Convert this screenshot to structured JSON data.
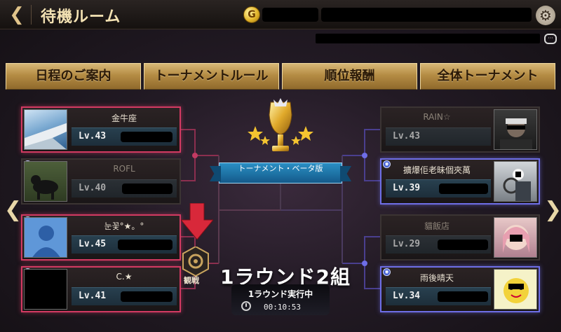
{
  "header": {
    "back_icon": "chevron-left-icon",
    "title": "待機ルーム",
    "coin_symbol": "G",
    "settings_icon": "gear-icon",
    "chat_icon": "chat-bubble-icon"
  },
  "tabs": [
    {
      "label": "日程のご案内"
    },
    {
      "label": "トーナメントルール"
    },
    {
      "label": "順位報酬"
    },
    {
      "label": "全体トーナメント"
    }
  ],
  "players_left": [
    {
      "name": "金牛座",
      "level": "Lv.43",
      "status": "active-red"
    },
    {
      "name": "ROFL",
      "level": "Lv.40",
      "status": "dimmed"
    },
    {
      "name": "눈꽃°★。°",
      "level": "Lv.45",
      "status": "active-red"
    },
    {
      "name": "C.★",
      "level": "Lv.41",
      "status": "active-red"
    }
  ],
  "players_right": [
    {
      "name": "RAIN☆",
      "level": "Lv.43",
      "status": "dimmed"
    },
    {
      "name": "擴爆佢老昧個夾萬",
      "level": "Lv.39",
      "status": "active-blue"
    },
    {
      "name": "貓飯店",
      "level": "Lv.29",
      "status": "dimmed"
    },
    {
      "name": "雨後晴天",
      "level": "Lv.34",
      "status": "active-blue"
    }
  ],
  "center": {
    "banner_text": "トーナメント・ベータ版",
    "watch_label": "観戦",
    "round_title": "1ラウンド2組",
    "round_status": "1ラウンド実行中",
    "timer": "00:10:53"
  },
  "colors": {
    "red_border": "#d23a62",
    "blue_border": "#6e6ee6",
    "tab_gold": "#b58c44",
    "banner_blue": "#2a8fc4"
  }
}
